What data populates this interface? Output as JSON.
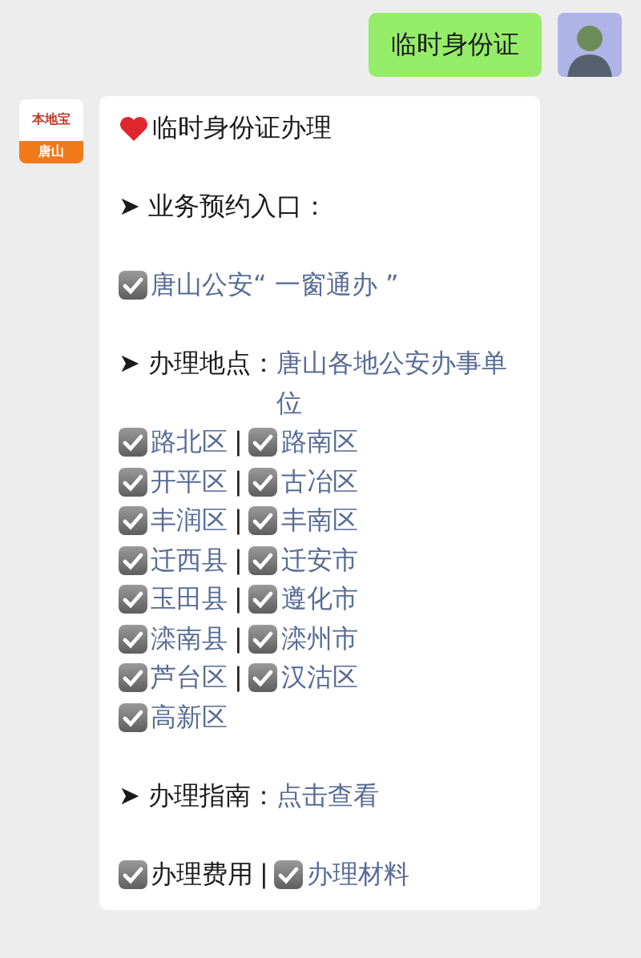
{
  "outgoing": {
    "text": "临时身份证"
  },
  "incoming": {
    "avatar": {
      "brand": "本地宝",
      "city": "唐山"
    },
    "lines": [
      {
        "kind": "title",
        "text": "临时身份证办理"
      },
      {
        "kind": "blank"
      },
      {
        "kind": "heading",
        "marker": "➤",
        "label": "业务预约入口："
      },
      {
        "kind": "blank"
      },
      {
        "kind": "items",
        "items": [
          {
            "text": "唐山公安“ 一窗通办 ”",
            "link": true,
            "checked": true
          }
        ]
      },
      {
        "kind": "blank"
      },
      {
        "kind": "heading",
        "marker": "➤",
        "label": "办理地点：",
        "link": "唐山各地公安办事单位"
      },
      {
        "kind": "items",
        "separator": "|",
        "items": [
          {
            "text": "路北区",
            "link": true,
            "checked": true
          },
          {
            "text": "路南区",
            "link": true,
            "checked": true
          }
        ]
      },
      {
        "kind": "items",
        "separator": "|",
        "items": [
          {
            "text": "开平区",
            "link": true,
            "checked": true
          },
          {
            "text": "古冶区",
            "link": true,
            "checked": true
          }
        ]
      },
      {
        "kind": "items",
        "separator": "|",
        "items": [
          {
            "text": "丰润区",
            "link": true,
            "checked": true
          },
          {
            "text": "丰南区",
            "link": true,
            "checked": true
          }
        ]
      },
      {
        "kind": "items",
        "separator": "|",
        "items": [
          {
            "text": "迁西县",
            "link": true,
            "checked": true
          },
          {
            "text": "迁安市",
            "link": true,
            "checked": true
          }
        ]
      },
      {
        "kind": "items",
        "separator": "|",
        "items": [
          {
            "text": "玉田县",
            "link": true,
            "checked": true
          },
          {
            "text": "遵化市",
            "link": true,
            "checked": true
          }
        ]
      },
      {
        "kind": "items",
        "separator": "|",
        "items": [
          {
            "text": "滦南县",
            "link": true,
            "checked": true
          },
          {
            "text": "滦州市",
            "link": true,
            "checked": true
          }
        ]
      },
      {
        "kind": "items",
        "separator": "|",
        "items": [
          {
            "text": "芦台区",
            "link": true,
            "checked": true
          },
          {
            "text": "汉沽区",
            "link": true,
            "checked": true
          }
        ]
      },
      {
        "kind": "items",
        "items": [
          {
            "text": "高新区",
            "link": true,
            "checked": true
          }
        ]
      },
      {
        "kind": "blank"
      },
      {
        "kind": "heading",
        "marker": "➤",
        "label": "办理指南：",
        "link": "点击查看"
      },
      {
        "kind": "blank"
      },
      {
        "kind": "items",
        "separator": "|",
        "items": [
          {
            "text": "办理费用",
            "link": false,
            "checked": true
          },
          {
            "text": "办理材料",
            "link": true,
            "checked": true
          }
        ]
      }
    ]
  }
}
